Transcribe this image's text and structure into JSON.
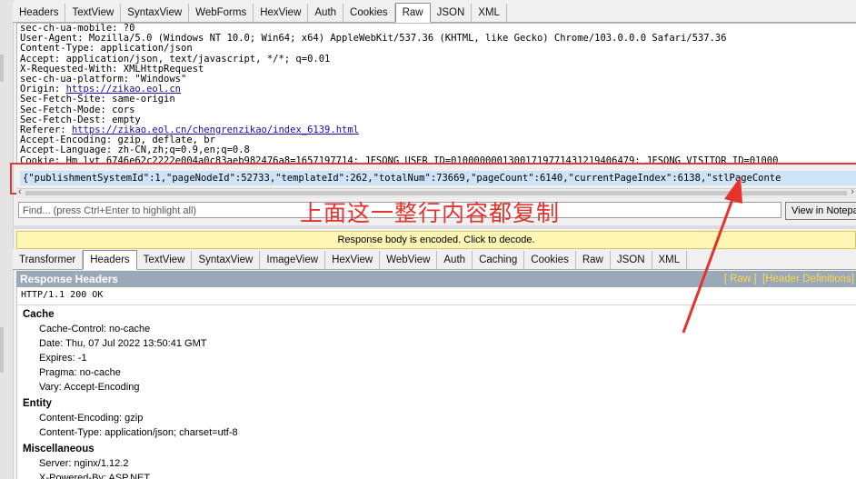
{
  "request_tabs": [
    "Headers",
    "TextView",
    "SyntaxView",
    "WebForms",
    "HexView",
    "Auth",
    "Cookies",
    "Raw",
    "JSON",
    "XML"
  ],
  "request_active_tab": "Raw",
  "raw_lines": [
    "sec-ch-ua-mobile: ?0",
    "User-Agent: Mozilla/5.0 (Windows NT 10.0; Win64; x64) AppleWebKit/537.36 (KHTML, like Gecko) Chrome/103.0.0.0 Safari/537.36",
    "Content-Type: application/json",
    "Accept: application/json, text/javascript, */*; q=0.01",
    "X-Requested-With: XMLHttpRequest",
    "sec-ch-ua-platform: \"Windows\"",
    "Origin: ",
    "Sec-Fetch-Site: same-origin",
    "Sec-Fetch-Mode: cors",
    "Sec-Fetch-Dest: empty",
    "Referer: ",
    "Accept-Encoding: gzip, deflate, br",
    "Accept-Language: zh-CN,zh;q=0.9,en;q=0.8",
    "Cookie: Hm_lvt_6746e62c2222e004a0c83aeb982476a8=1657197714; JFSONG_USER_ID=01000000013001719771431219406479; JFSONG_VISITOR_ID=01000"
  ],
  "origin_link": "https://zikao.eol.cn",
  "referer_link": "https://zikao.eol.cn/chengrenzikao/index_6139.html",
  "request_body": "{\"publishmentSystemId\":1,\"pageNodeId\":52733,\"templateId\":262,\"totalNum\":73669,\"pageCount\":6140,\"currentPageIndex\":6138,\"stlPageConte",
  "find_placeholder": "Find... (press Ctrl+Enter to highlight all)",
  "view_in_notepad": "View in Notepad",
  "annotation_text": "上面这一整行内容都复制",
  "encoded_notice": "Response body is encoded. Click to decode.",
  "response_tabs": [
    "Transformer",
    "Headers",
    "TextView",
    "SyntaxView",
    "ImageView",
    "HexView",
    "WebView",
    "Auth",
    "Caching",
    "Cookies",
    "Raw",
    "JSON",
    "XML"
  ],
  "response_active_tab": "Headers",
  "response_headers_title": "Response Headers",
  "raw_link": "[ Raw ]",
  "header_defs_link": "[Header Definitions]",
  "status_line": "HTTP/1.1 200 OK",
  "groups": [
    {
      "name": "Cache",
      "items": [
        "Cache-Control: no-cache",
        "Date: Thu, 07 Jul 2022 13:50:41 GMT",
        "Expires: -1",
        "Pragma: no-cache",
        "Vary: Accept-Encoding"
      ]
    },
    {
      "name": "Entity",
      "items": [
        "Content-Encoding: gzip",
        "Content-Type: application/json; charset=utf-8"
      ]
    },
    {
      "name": "Miscellaneous",
      "items": [
        "Server: nginx/1.12.2",
        "X-Powered-By: ASP.NET"
      ]
    }
  ],
  "colors": {
    "annotation": "#e5322d",
    "selection": "#cfe3f7",
    "link": "#1a0dab",
    "notice_bg": "#fff6b4"
  }
}
